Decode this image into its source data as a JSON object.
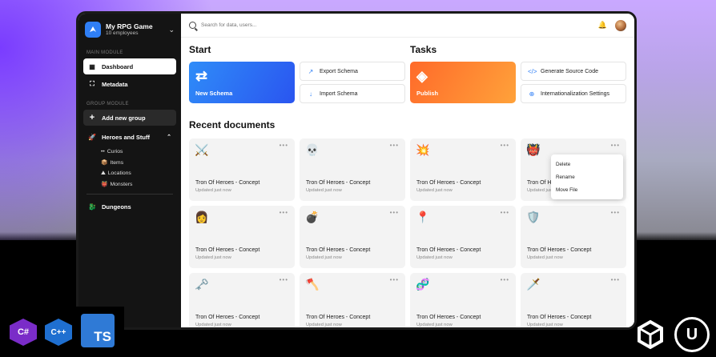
{
  "app": {
    "name": "My RPG Game",
    "subtitle": "10 employees"
  },
  "sidebar": {
    "main_label": "MAIN MODULE",
    "dashboard": "Dashboard",
    "metadata": "Metadata",
    "group_label": "GROUP MODULE",
    "add_group": "Add new group",
    "group_name": "Heroes and Stuff",
    "sub_items": [
      "Curios",
      "Items",
      "Locations",
      "Monsters"
    ],
    "dungeons": "Dungeons"
  },
  "search": {
    "placeholder": "Search for data, users..."
  },
  "start": {
    "title": "Start",
    "new_schema": "New Schema",
    "export_schema": "Export Schema",
    "import_schema": "Import Schema"
  },
  "tasks": {
    "title": "Tasks",
    "publish": "Publish",
    "generate": "Generate Source Code",
    "i18n": "Internationalization Settings"
  },
  "recent": {
    "title": "Recent documents",
    "docs": [
      {
        "emoji": "⚔️",
        "title": "Tron Of Heroes - Concept",
        "updated": "Updated just now"
      },
      {
        "emoji": "💀",
        "title": "Tron Of Heroes - Concept",
        "updated": "Updated just now"
      },
      {
        "emoji": "💥",
        "title": "Tron Of Heroes - Concept",
        "updated": "Updated just now"
      },
      {
        "emoji": "👹",
        "title": "Tron Of He",
        "updated": "Updated just"
      },
      {
        "emoji": "👩",
        "title": "Tron Of Heroes - Concept",
        "updated": "Updated just now"
      },
      {
        "emoji": "💣",
        "title": "Tron Of Heroes - Concept",
        "updated": "Updated just now"
      },
      {
        "emoji": "📍",
        "title": "Tron Of Heroes - Concept",
        "updated": "Updated just now"
      },
      {
        "emoji": "🛡️",
        "title": "Tron Of Heroes - Concept",
        "updated": "Updated just now"
      },
      {
        "emoji": "🗝️",
        "title": "Tron Of Heroes - Concept",
        "updated": "Updated just now"
      },
      {
        "emoji": "🪓",
        "title": "Tron Of Heroes - Concept",
        "updated": "Updated just now"
      },
      {
        "emoji": "🧬",
        "title": "Tron Of Heroes - Concept",
        "updated": "Updated just now"
      },
      {
        "emoji": "🗡️",
        "title": "Tron Of Heroes - Concept",
        "updated": "Updated just now"
      }
    ]
  },
  "context_menu": {
    "items": [
      "Delete",
      "Rename",
      "Move File"
    ]
  },
  "badges": {
    "csharp": "C#",
    "cpp": "C++",
    "ts": "TS"
  },
  "colors": {
    "new_schema": "#2f6bf6",
    "publish": "#ff7a2f",
    "accent": "#2f7ff6"
  }
}
